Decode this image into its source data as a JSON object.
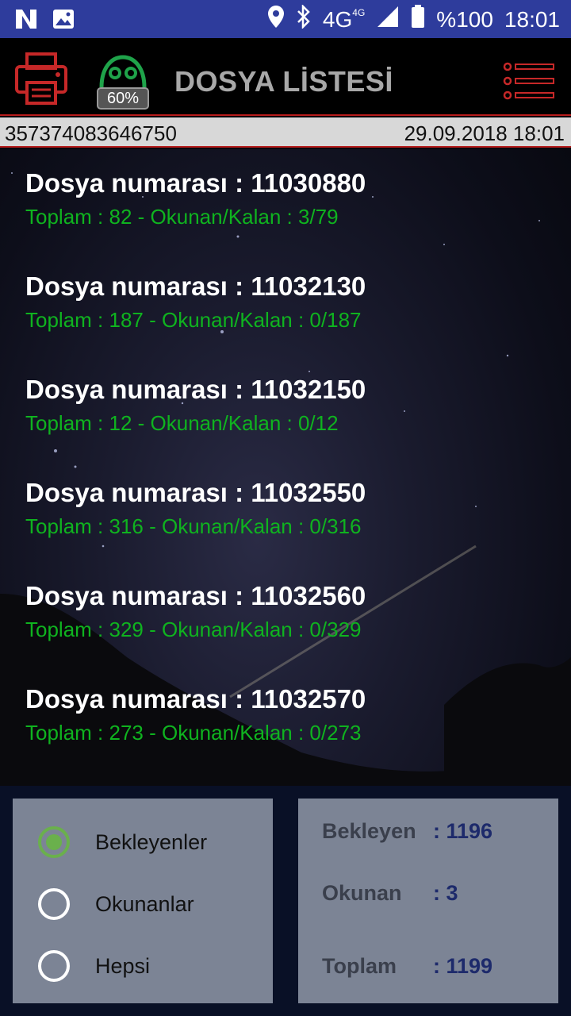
{
  "status_bar": {
    "network": "4G",
    "network_small": "4G",
    "battery_text": "%100",
    "time": "18:01"
  },
  "app_bar": {
    "title": "DOSYA LİSTESİ",
    "robot_badge": "60%"
  },
  "info_row": {
    "device_id": "357374083646750",
    "datetime": "29.09.2018 18:01"
  },
  "files": [
    {
      "title": "Dosya numarası : 11030880",
      "summary": "Toplam : 82 - Okunan/Kalan : 3/79"
    },
    {
      "title": "Dosya numarası : 11032130",
      "summary": "Toplam : 187 - Okunan/Kalan : 0/187"
    },
    {
      "title": "Dosya numarası : 11032150",
      "summary": "Toplam : 12 - Okunan/Kalan : 0/12"
    },
    {
      "title": "Dosya numarası : 11032550",
      "summary": "Toplam : 316 - Okunan/Kalan : 0/316"
    },
    {
      "title": "Dosya numarası : 11032560",
      "summary": "Toplam : 329 - Okunan/Kalan : 0/329"
    },
    {
      "title": "Dosya numarası : 11032570",
      "summary": "Toplam : 273 - Okunan/Kalan : 0/273"
    }
  ],
  "filter": {
    "options": [
      {
        "label": "Bekleyenler",
        "checked": true
      },
      {
        "label": "Okunanlar",
        "checked": false
      },
      {
        "label": "Hepsi",
        "checked": false
      }
    ]
  },
  "stats": {
    "waiting_label": "Bekleyen",
    "waiting_value": ": 1196",
    "read_label": "Okunan",
    "read_value": ": 3",
    "total_label": "Toplam",
    "total_value": ": 1199"
  },
  "colors": {
    "status_bar": "#2e3c9c",
    "accent_red": "#b71c1c",
    "summary_green": "#0fb31f",
    "radio_green": "#6ab04c"
  }
}
